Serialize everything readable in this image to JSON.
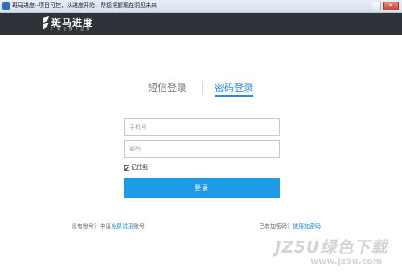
{
  "window": {
    "title": "斑马进度--项目可控，从进度开始，帮您把握现在洞见未来",
    "minimize_symbol": "–",
    "close_symbol": "✕"
  },
  "brand": {
    "logo_text": "斑马进度",
    "slogan": "广 软 企 旗 下 品 牌"
  },
  "tabs": {
    "sms_login": "短信登录",
    "password_login": "密码登录",
    "active": "password_login"
  },
  "form": {
    "phone_placeholder": "手机号",
    "password_placeholder": "密码",
    "remember_label": "记住我",
    "remember_checked": true,
    "login_button": "登录"
  },
  "footer": {
    "no_account_prefix": "没有账号？申请",
    "free_trial_link": "免费试用",
    "no_account_suffix": "账号",
    "have_code_text": "已有加密码？",
    "use_code_link": "使用加密码"
  },
  "watermark": {
    "main": "JZ5U绿色下载",
    "sub": "www.jz5u.com"
  },
  "colors": {
    "brand_bar": "#2d3339",
    "accent": "#1e9be6",
    "active_tab": "#2a8ae0"
  }
}
